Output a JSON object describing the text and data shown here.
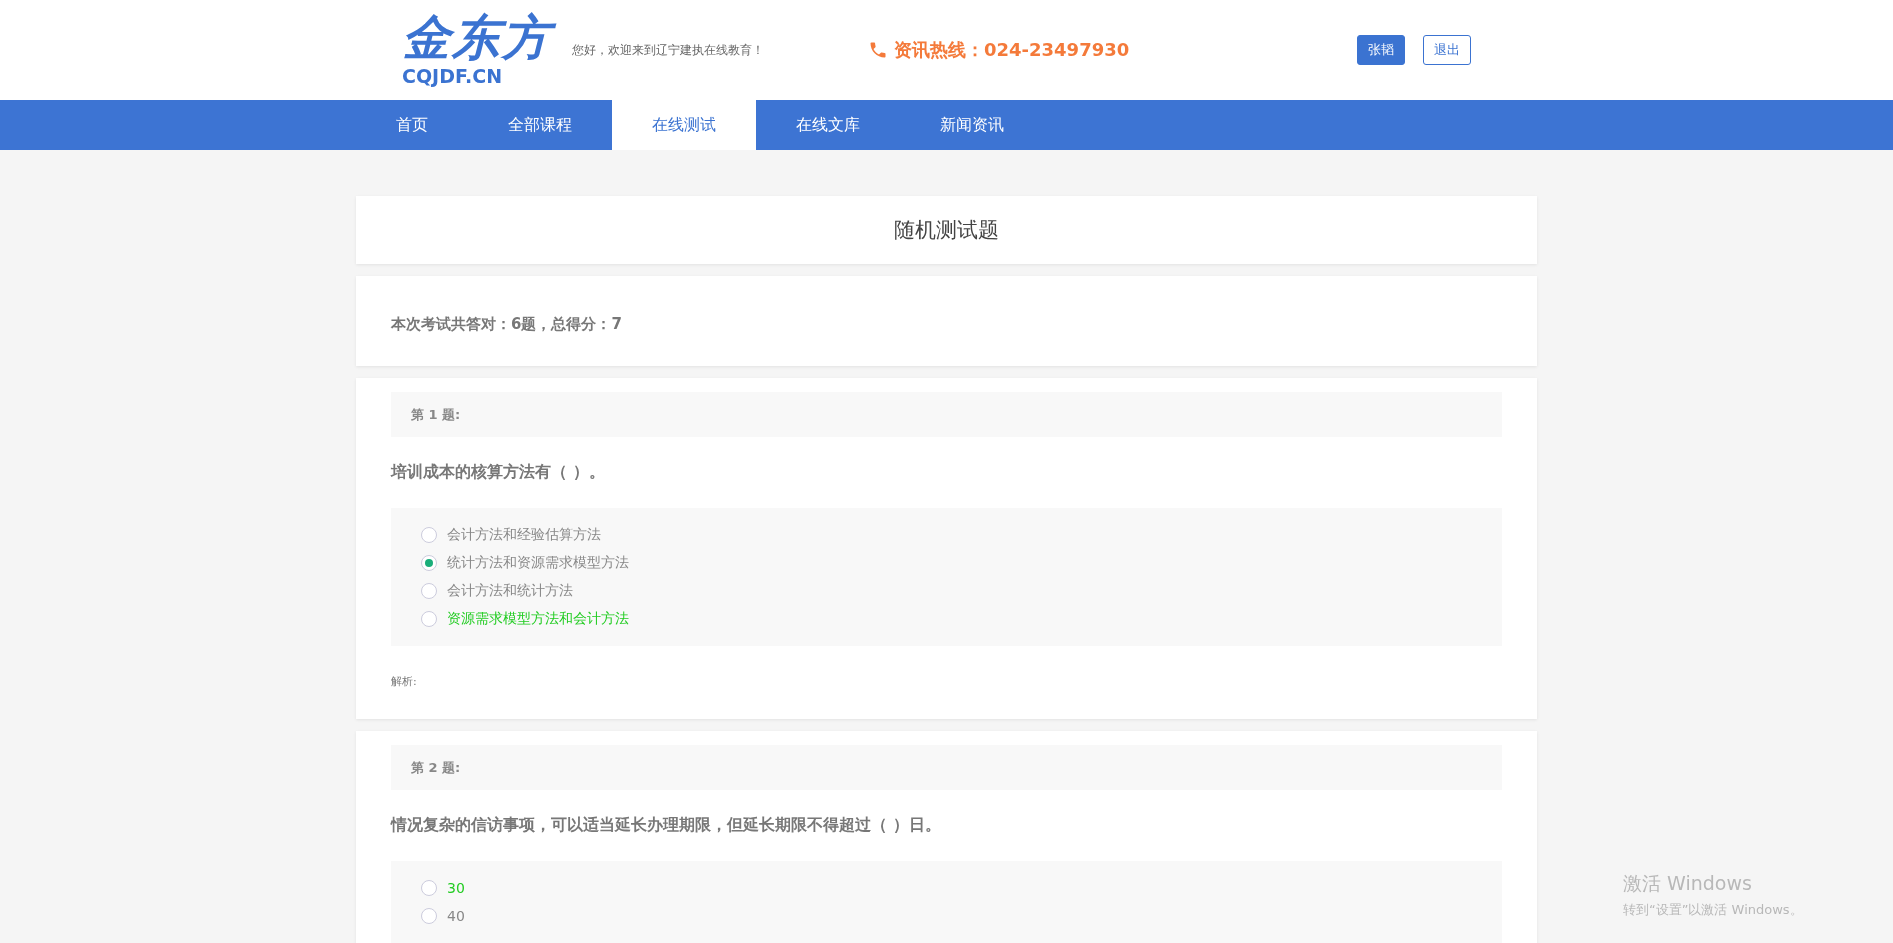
{
  "header": {
    "logo": {
      "title": "金东方",
      "subtitle": "CQJDF.CN"
    },
    "welcome": "您好，欢迎来到辽宁建执在线教育！",
    "hotline": "资讯热线：024-23497930",
    "user_button": "张韬",
    "logout_button": "退出"
  },
  "nav": [
    {
      "label": "首页",
      "selected": false
    },
    {
      "label": "全部课程",
      "selected": false
    },
    {
      "label": "在线测试",
      "selected": true
    },
    {
      "label": "在线文库",
      "selected": false
    },
    {
      "label": "新闻资讯",
      "selected": false
    }
  ],
  "page_title": "随机测试题",
  "summary": "本次考试共答对：6题，总得分：7",
  "questions": [
    {
      "number": "第 **1** 题:",
      "text": "培训成本的核算方法有（ ）。",
      "options": [
        {
          "label": "会计方法和经验估算方法",
          "selected": false,
          "correct": false
        },
        {
          "label": "统计方法和资源需求模型方法",
          "selected": true,
          "correct": false
        },
        {
          "label": "会计方法和统计方法",
          "selected": false,
          "correct": false
        },
        {
          "label": "资源需求模型方法和会计方法",
          "selected": false,
          "correct": true
        }
      ],
      "analysis": "解析:"
    },
    {
      "number": "第 **2** 题:",
      "text": "情况复杂的信访事项，可以适当延长办理期限，但延长期限不得超过（ ）日。",
      "options": [
        {
          "label": "30",
          "selected": false,
          "correct": true
        },
        {
          "label": "40",
          "selected": false,
          "correct": false
        }
      ]
    }
  ],
  "system_overlay": {
    "title": "激活 Windows",
    "subtitle": "转到“设置”以激活 Windows。"
  }
}
